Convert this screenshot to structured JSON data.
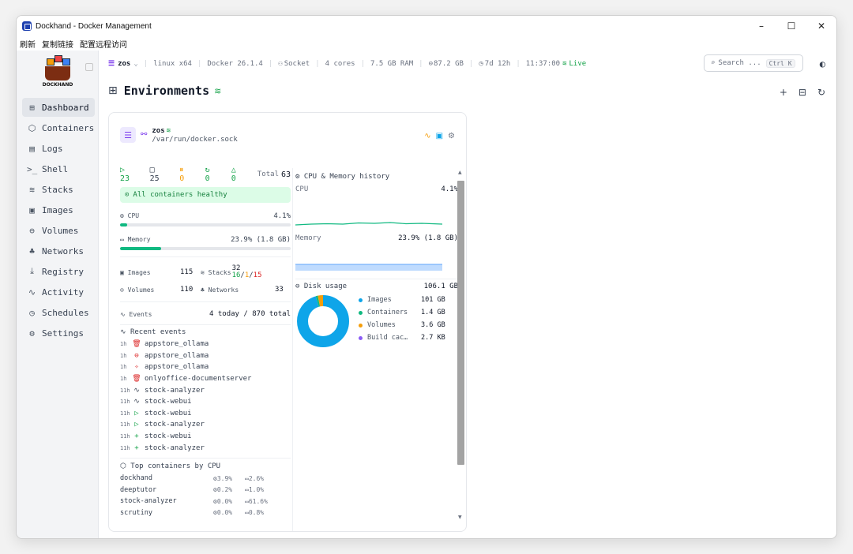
{
  "window": {
    "title": "Dockhand - Docker Management",
    "minimize": "–",
    "maximize": "☐",
    "close": "✕"
  },
  "menubar": {
    "items": [
      "刷新",
      "复制链接",
      "配置远程访问"
    ]
  },
  "logo": {
    "text": "DOCKHAND"
  },
  "sidebar": {
    "items": [
      {
        "label": "Dashboard",
        "icon": "dashboard-icon",
        "glyph": "⊞",
        "active": true
      },
      {
        "label": "Containers",
        "icon": "cube-icon",
        "glyph": "⬡"
      },
      {
        "label": "Logs",
        "icon": "logs-icon",
        "glyph": "▤"
      },
      {
        "label": "Shell",
        "icon": "terminal-icon",
        "glyph": ">_"
      },
      {
        "label": "Stacks",
        "icon": "layers-icon",
        "glyph": "≋"
      },
      {
        "label": "Images",
        "icon": "images-icon",
        "glyph": "▣"
      },
      {
        "label": "Volumes",
        "icon": "volume-icon",
        "glyph": "⊖"
      },
      {
        "label": "Networks",
        "icon": "network-icon",
        "glyph": "♣"
      },
      {
        "label": "Registry",
        "icon": "download-icon",
        "glyph": "⤓"
      },
      {
        "label": "Activity",
        "icon": "activity-icon",
        "glyph": "∿"
      },
      {
        "label": "Schedules",
        "icon": "timer-icon",
        "glyph": "◷"
      },
      {
        "label": "Settings",
        "icon": "gear-icon",
        "glyph": "⚙"
      }
    ]
  },
  "topbar": {
    "host": "zos",
    "os": "linux x64",
    "docker": "Docker 26.1.4",
    "socket": "Socket",
    "cores": "4 cores",
    "ram": "7.5 GB RAM",
    "disk": "87.2 GB",
    "uptime": "7d 12h",
    "time": "11:37:00",
    "live": "Live",
    "search_placeholder": "Search ...",
    "shortcut": "Ctrl K"
  },
  "page": {
    "title": "Environments"
  },
  "env": {
    "name": "zos",
    "path": "/var/run/docker.sock",
    "counts": {
      "running": "23",
      "stopped": "25",
      "paused": "0",
      "restarting": "0",
      "unhealthy": "0",
      "total_label": "Total",
      "total": "63"
    },
    "health": "All containers healthy",
    "cpu": {
      "label": "CPU",
      "value": "4.1%",
      "pct": 4.1
    },
    "memory": {
      "label": "Memory",
      "value": "23.9% (1.8 GB)",
      "pct": 23.9
    },
    "images": {
      "label": "Images",
      "value": "115"
    },
    "stacks": {
      "label": "Stacks",
      "total": "32",
      "running": "16",
      "partial": "1",
      "stopped": "15"
    },
    "volumes": {
      "label": "Volumes",
      "value": "110"
    },
    "networks": {
      "label": "Networks",
      "value": "33"
    },
    "events": {
      "label": "Events",
      "value": "4 today / 870 total"
    },
    "recent_title": "Recent events",
    "recent": [
      {
        "t": "1h",
        "icon": "trash-icon",
        "glyph": "🗑",
        "color": "#dc2626",
        "name": "appstore_ollama"
      },
      {
        "t": "1h",
        "icon": "stop-circle-icon",
        "glyph": "⊖",
        "color": "#dc2626",
        "name": "appstore_ollama"
      },
      {
        "t": "1h",
        "icon": "kill-icon",
        "glyph": "✧",
        "color": "#dc2626",
        "name": "appstore_ollama"
      },
      {
        "t": "1h",
        "icon": "trash-icon",
        "glyph": "🗑",
        "color": "#dc2626",
        "name": "onlyoffice-documentserver"
      },
      {
        "t": "11h",
        "icon": "activity-icon",
        "glyph": "∿",
        "color": "#374151",
        "name": "stock-analyzer"
      },
      {
        "t": "11h",
        "icon": "activity-icon",
        "glyph": "∿",
        "color": "#374151",
        "name": "stock-webui"
      },
      {
        "t": "11h",
        "icon": "play-icon",
        "glyph": "▷",
        "color": "#16a34a",
        "name": "stock-webui"
      },
      {
        "t": "11h",
        "icon": "play-icon",
        "glyph": "▷",
        "color": "#16a34a",
        "name": "stock-analyzer"
      },
      {
        "t": "11h",
        "icon": "plus-icon",
        "glyph": "+",
        "color": "#16a34a",
        "name": "stock-webui"
      },
      {
        "t": "11h",
        "icon": "plus-icon",
        "glyph": "+",
        "color": "#16a34a",
        "name": "stock-analyzer"
      }
    ],
    "top_title": "Top containers by CPU",
    "top": [
      {
        "name": "dockhand",
        "cpu": "3.9%",
        "mem": "2.6%"
      },
      {
        "name": "deeptutor",
        "cpu": "0.2%",
        "mem": "1.0%"
      },
      {
        "name": "stock-analyzer",
        "cpu": "0.0%",
        "mem": "61.6%"
      },
      {
        "name": "scrutiny",
        "cpu": "0.0%",
        "mem": "0.8%"
      }
    ],
    "history": {
      "title": "CPU & Memory history",
      "cpu_label": "CPU",
      "cpu_value": "4.1%",
      "mem_label": "Memory",
      "mem_value": "23.9% (1.8 GB)"
    },
    "disk": {
      "title": "Disk usage",
      "total": "106.1 GB",
      "segments": [
        {
          "name": "Images",
          "value": "101 GB",
          "gb": 101,
          "color": "#0ea5e9"
        },
        {
          "name": "Containers",
          "value": "1.4 GB",
          "gb": 1.4,
          "color": "#10b981"
        },
        {
          "name": "Volumes",
          "value": "3.6 GB",
          "gb": 3.6,
          "color": "#f59e0b"
        },
        {
          "name": "Build cac…",
          "value": "2.7 KB",
          "gb": 2.7e-06,
          "color": "#8b5cf6"
        }
      ]
    }
  }
}
